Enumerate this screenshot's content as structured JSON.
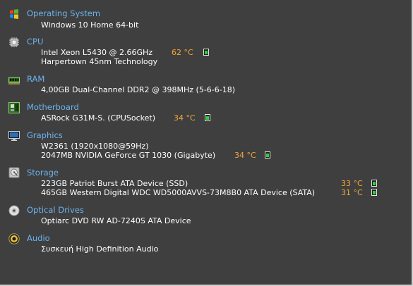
{
  "sections": {
    "os": {
      "title": "Operating System",
      "icon": "windows-logo-icon",
      "lines": [
        "Windows 10 Home 64-bit"
      ]
    },
    "cpu": {
      "title": "CPU",
      "icon": "cpu-chip-icon",
      "lines": [
        "Intel Xeon L5430 @ 2.66GHz",
        "Harpertown 45nm Technology"
      ],
      "temp": "62 °C"
    },
    "ram": {
      "title": "RAM",
      "icon": "ram-module-icon",
      "lines": [
        "4,00GB Dual-Channel DDR2 @ 398MHz (5-6-6-18)"
      ]
    },
    "motherboard": {
      "title": "Motherboard",
      "icon": "motherboard-icon",
      "lines": [
        "ASRock G31M-S. (CPUSocket)"
      ],
      "temp": "34 °C"
    },
    "graphics": {
      "title": "Graphics",
      "icon": "monitor-icon",
      "lines": [
        "W2361 (1920x1080@59Hz)",
        "2047MB NVIDIA GeForce GT 1030 (Gigabyte)"
      ],
      "temp": "34 °C"
    },
    "storage": {
      "title": "Storage",
      "icon": "hard-drive-icon",
      "lines": [
        "223GB Patriot Burst ATA Device (SSD)",
        "465GB Western Digital WDC WD5000AVVS-73M8B0 ATA Device (SATA)"
      ],
      "temps": [
        "33 °C",
        "31 °C"
      ]
    },
    "optical": {
      "title": "Optical Drives",
      "icon": "optical-disc-icon",
      "lines": [
        "Optiarc DVD RW AD-7240S ATA Device"
      ]
    },
    "audio": {
      "title": "Audio",
      "icon": "speaker-icon",
      "lines": [
        "Συσκευή High Definition Audio"
      ]
    }
  },
  "colors": {
    "background": "#3f3f3f",
    "heading": "#6cb3ee",
    "temperature": "#f4a63a",
    "text": "#ffffff",
    "thermometer": "#2bd23a"
  }
}
